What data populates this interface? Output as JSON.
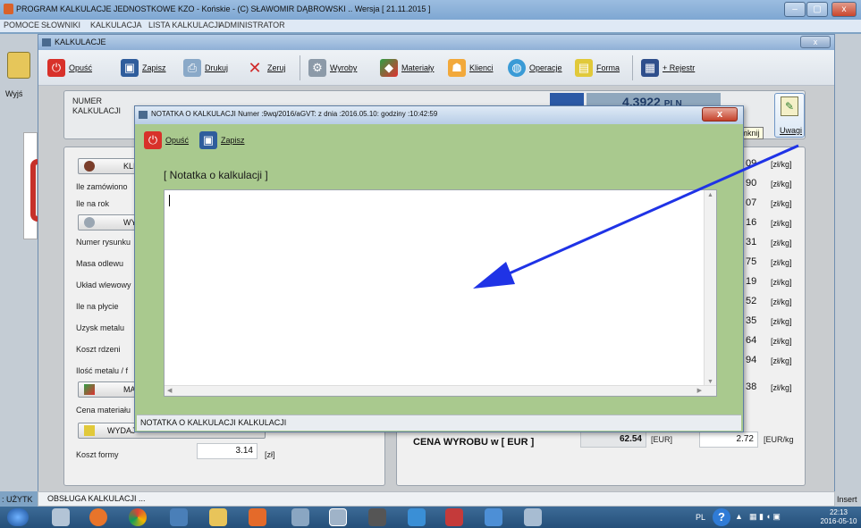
{
  "app": {
    "title": "PROGRAM KALKULACJE JEDNOSTKOWE KZO - Końskie - (C) SŁAWOMIR DĄBROWSKI .. Wersja [ 21.11.2015 ]",
    "menu": [
      "POMOCE",
      "SŁOWNIKI",
      "KALKULACJA",
      "LISTA KALKULACJI",
      "ADMINISTRATOR"
    ],
    "left_label": "Wyjś",
    "status_left": ": UŻYTK",
    "status_right": "Insert",
    "status_main": "OBSŁUGA KALKULACJI ..."
  },
  "inner": {
    "title": "KALKULACJE",
    "toolbar": [
      "Opuść",
      "Zapisz",
      "Drukuj",
      "Zeruj",
      "Wyroby",
      "Materiały",
      "Klienci",
      "Operacje",
      "Forma",
      "+ Rejestr"
    ],
    "numer_label_1": "NUMER",
    "numer_label_2": "KALKULACJI",
    "price_display": "4.3922",
    "price_currency": "PLN",
    "uwagi_label": "Uwagi",
    "zamknij_tooltip": "Zamknij"
  },
  "left_panel": {
    "klient_button": "KLIE",
    "wyr_button": "WYR",
    "mate_button": "MATE",
    "wydaj_button": "WYDAJ",
    "labels": [
      "Ile zamówiono",
      "Ile na rok",
      "Numer rysunku",
      "Masa odlewu",
      "Układ wlewowy",
      "Ile na płycie",
      "Uzysk metalu",
      "Koszt rdzeni",
      "Ilość metalu / f",
      "Cena materiału"
    ],
    "koszt_formy_label": "Koszt formy",
    "koszt_formy_value": "3.14",
    "koszt_formy_unit": "[zł]"
  },
  "right_values": [
    "09",
    "90",
    "07",
    "16",
    "31",
    "75",
    "19",
    "52",
    "35",
    "64",
    "94",
    "38"
  ],
  "right_unit": "[zł/kg]",
  "cena_wyrobu": {
    "label": "CENA WYROBU w [ EUR ]",
    "value": "62.54",
    "unit": "[EUR]",
    "value2": "2.72",
    "unit2": "[EUR/kg"
  },
  "dialog": {
    "title": "NOTATKA O KALKULACJI Numer :9wq/2016/aGVT: z dnia :2016.05.10: godziny :10:42:59",
    "close": "x",
    "toolbar": [
      "Opuść",
      "Zapisz"
    ],
    "header": "[ Notatka o kalkulacji ]",
    "note_text": "",
    "status": "NOTATKA O KALKULACJI KALKULACJI"
  },
  "taskbar": {
    "lang": "PL",
    "time": "22:13",
    "date": "2016-05-10"
  },
  "colors": {
    "dialog_bg": "#a9c98e",
    "annotation_arrow": "#1f33e6",
    "title_bar": "#8fb0d6"
  }
}
